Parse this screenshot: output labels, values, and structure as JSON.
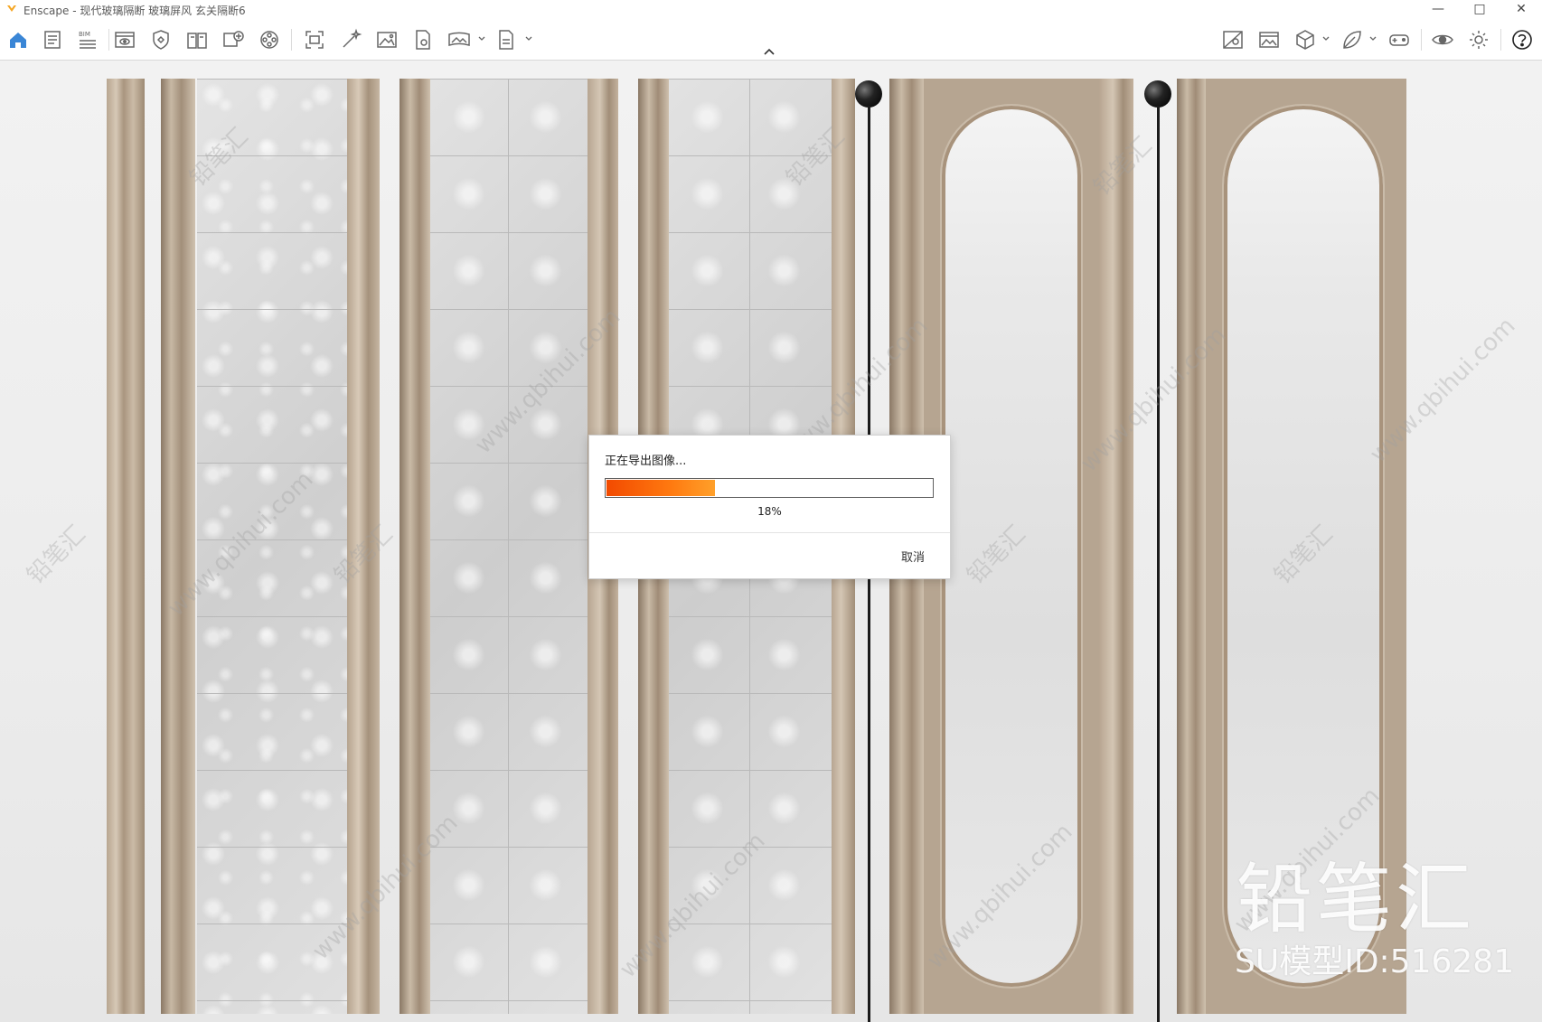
{
  "window": {
    "title": "Enscape - 现代玻璃隔断 玻璃屏风 玄关隔断6",
    "controls": [
      "minimize-icon",
      "maximize-icon",
      "close-icon"
    ]
  },
  "toolbar": {
    "left_icons": [
      "home-icon",
      "document-list-icon",
      "bim-icon",
      "view-window-icon",
      "shield-icon",
      "book-icon",
      "add-view-icon",
      "video-reel-icon",
      "screenshot-frame-icon",
      "magic-wand-icon",
      "image-icon",
      "document-settings-icon",
      "panorama-icon",
      "export-file-icon"
    ],
    "bim_label": "BIM",
    "right_icons": [
      "map-view-icon",
      "gallery-icon",
      "cube-icon",
      "leaf-icon",
      "gamepad-icon",
      "eye-icon",
      "settings-icon",
      "help-icon"
    ],
    "accent_color": "#3a86d6"
  },
  "dialog": {
    "title": "正在导出图像...",
    "progress_percent": 18,
    "progress_label": "18%",
    "cancel_label": "取消",
    "progress_color": "#f24a00"
  },
  "watermark": {
    "brand": "铅笔汇",
    "model_id": "SU模型ID:516281",
    "url": "www.qbihui.com"
  }
}
